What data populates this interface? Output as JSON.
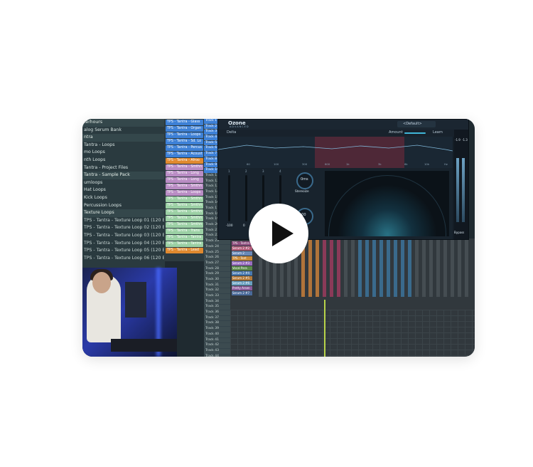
{
  "browser": {
    "items": [
      {
        "label": "terhours",
        "kind": "folder"
      },
      {
        "label": "alog Serum Bank",
        "kind": "item"
      },
      {
        "label": "ntra",
        "kind": "folder"
      },
      {
        "label": "Tantra - Loops",
        "kind": "item"
      },
      {
        "label": "mo Loops",
        "kind": "item"
      },
      {
        "label": "nth Loops",
        "kind": "item"
      },
      {
        "label": "Tantra - Project Files",
        "kind": "item"
      },
      {
        "label": "Tantra - Sample Pack",
        "kind": "folder"
      },
      {
        "label": "umloops",
        "kind": "item"
      },
      {
        "label": "Hat Loops",
        "kind": "item"
      },
      {
        "label": "Kick Loops",
        "kind": "item"
      },
      {
        "label": "Percussion Loops",
        "kind": "item"
      },
      {
        "label": "Texture Loops",
        "kind": "folder"
      },
      {
        "label": "TPS - Tantra - Texture Loop 01 (120 BPM)",
        "kind": "file"
      },
      {
        "label": "TPS - Tantra - Texture Loop 02 (120 BPM)",
        "kind": "file"
      },
      {
        "label": "TPS - Tantra - Texture Loop 03 (120 BPM)",
        "kind": "file"
      },
      {
        "label": "TPS - Tantra - Texture Loop 04 (120 BPM)",
        "kind": "file"
      },
      {
        "label": "TPS - Tantra - Texture Loop 05 (120 BPM)",
        "kind": "file"
      },
      {
        "label": "TPS - Tantra - Texture Loop 06 (120 BPM)",
        "kind": "file"
      }
    ]
  },
  "playlist": {
    "clips": [
      {
        "label": "TPS - Tantra - Glass",
        "color": "#3d80d6"
      },
      {
        "label": "TPS - Tantra - Organ",
        "color": "#3d80d6"
      },
      {
        "label": "TPS - Tantra - Loops",
        "color": "#3d80d6"
      },
      {
        "label": "TPS - Tantra - Sd. Lo",
        "color": "#3d80d6"
      },
      {
        "label": "TPS - Tantra - Percus",
        "color": "#3d80d6"
      },
      {
        "label": "TPS - Tantra - Acoust",
        "color": "#3d80d6"
      },
      {
        "label": "TPS - Tantra - Afroo",
        "color": "#e0892f"
      },
      {
        "label": "TPS - Tantra - Smthn",
        "color": "#b98cc4"
      },
      {
        "label": "TPS - Tantra - Long",
        "color": "#b98cc4"
      },
      {
        "label": "TPS - Tantra - Long",
        "color": "#b98cc4"
      },
      {
        "label": "TPS - Tantra - Smthn",
        "color": "#b98cc4"
      },
      {
        "label": "TPS - Tantra - Loops",
        "color": "#b98cc4"
      },
      {
        "label": "TPS - Tantra - Smthn",
        "color": "#9bd0a4"
      },
      {
        "label": "TPS - Tantra - Smthn",
        "color": "#9bd0a4"
      },
      {
        "label": "TPS - Tantra - Smthn",
        "color": "#9bd0a4"
      },
      {
        "label": "TPS - Tantra - Smthn",
        "color": "#9bd0a4"
      },
      {
        "label": "TPS - Tantra - Smthn",
        "color": "#9bd0a4"
      },
      {
        "label": "TPS - Tantra - Trans",
        "color": "#9bd0a4"
      },
      {
        "label": "TPS - Tantra - Tantra",
        "color": "#9bd0a4"
      },
      {
        "label": "TPS - Tantra - Tantra",
        "color": "#9bd0a4"
      },
      {
        "label": "TPS - Tantra - Lead",
        "color": "#e0892f"
      }
    ]
  },
  "tracks": {
    "labels": [
      "Track 1",
      "Track 2",
      "Track 3",
      "Track 4",
      "Track 5",
      "Track 6",
      "Track 7",
      "Track 8",
      "Track 9",
      "Track 10",
      "Track 11",
      "Track 12",
      "Track 13",
      "Track 14",
      "Track 15",
      "Track 16",
      "Track 17",
      "Track 18",
      "Track 19",
      "Track 20",
      "Track 21",
      "Track 22",
      "Track 23",
      "Track 24",
      "Track 25",
      "Track 26",
      "Track 27",
      "Track 28",
      "Track 29",
      "Track 30",
      "Track 31",
      "Track 32",
      "Track 33",
      "Track 34",
      "Track 35",
      "Track 36",
      "Track 37",
      "Track 38",
      "Track 39",
      "Track 40",
      "Track 41",
      "Track 42",
      "Track 43",
      "Track 44",
      "Track 45",
      "Track 46",
      "Track 47",
      "Track 48",
      "Track 49"
    ]
  },
  "mixer": {
    "inserts": [
      "TPS - Tantra",
      "Serum 2 #2",
      "Serum 2",
      "TPS - Tant",
      "Serum 2 #3",
      "Vocal Para",
      "Serum 2 #4",
      "Serum 2 #5",
      "Serum 2 #6",
      "Pretty Arsen",
      "Serum 2 #7"
    ]
  },
  "ozone": {
    "title": "Ozone",
    "subtitle": "ADVANCED",
    "preset": "<Default>",
    "delta_label": "Delta",
    "learn_label": "Learn",
    "amount_label": "Amount",
    "freq_labels": [
      "60",
      "100",
      "300",
      "600",
      "1k",
      "3k",
      "6k",
      "10k",
      "Hz"
    ],
    "band_labels": [
      "1",
      "2",
      "3",
      "4"
    ],
    "fader_values": [
      "-100",
      "0",
      "0",
      "100"
    ],
    "knob_value_1": "0ms",
    "stereoize_label": "Stereoize",
    "knob_value_2": "100",
    "sides_label": "Sides",
    "meter_values": [
      "-1.9",
      "-1.3"
    ],
    "bypass_label": "Bypass",
    "colors": {
      "accent": "#3fb6d8",
      "band_highlight": "#7a2a3a"
    }
  },
  "video": {
    "play_icon": "play-icon"
  }
}
